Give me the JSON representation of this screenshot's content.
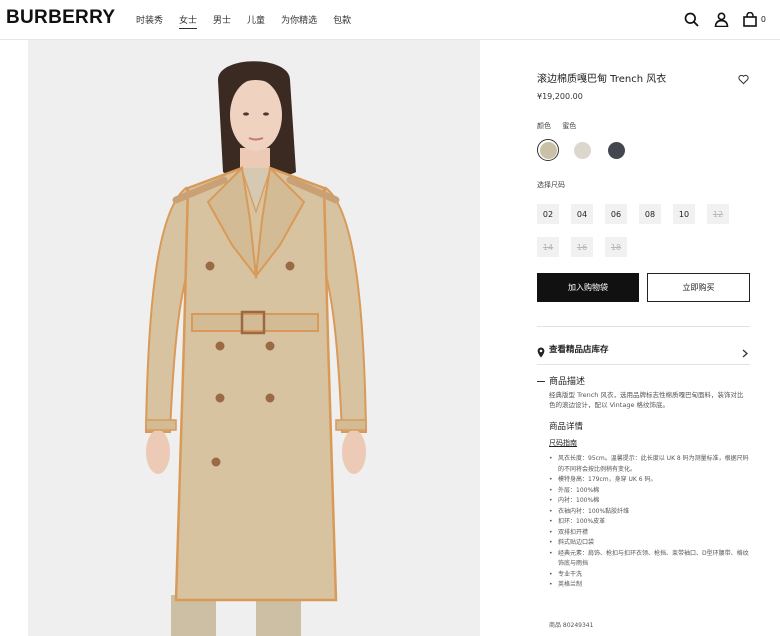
{
  "header": {
    "logo": "BURBERRY",
    "nav": [
      "时装秀",
      "女士",
      "男士",
      "儿童",
      "为你精选",
      "包款"
    ],
    "active_nav": "女士",
    "bag_count": "0"
  },
  "icons": {
    "search": "search-icon",
    "account": "user-icon",
    "bag": "shopping-bag-icon",
    "wishlist": "heart-icon",
    "store": "location-pin-icon",
    "chevron": "chevron-right-icon"
  },
  "product": {
    "title": "滚边棉质嘎巴甸 Trench 风衣",
    "price": "¥19,200.00",
    "colour_label": "颜色",
    "colour_selected": "蜜色",
    "colours": [
      {
        "name": "honey",
        "hex": "#c9c0a6",
        "selected": true
      },
      {
        "name": "stone",
        "hex": "#dcd7cc",
        "selected": false
      },
      {
        "name": "navy",
        "hex": "#45474f",
        "selected": false
      }
    ],
    "size_label": "选择尺码",
    "sizes": [
      {
        "label": "02",
        "available": true
      },
      {
        "label": "04",
        "available": true
      },
      {
        "label": "06",
        "available": true
      },
      {
        "label": "08",
        "available": true
      },
      {
        "label": "10",
        "available": true
      },
      {
        "label": "12",
        "available": false
      },
      {
        "label": "14",
        "available": false
      },
      {
        "label": "16",
        "available": false
      },
      {
        "label": "18",
        "available": false
      }
    ],
    "add_to_cart": "加入购物袋",
    "buy_now": "立即购买",
    "store_stock": "查看精品店库存",
    "description_title": "商品描述",
    "description": "经典版型 Trench 风衣，选用品牌标志性棉质嘎巴甸面料，装饰对比色的滚边设计，配以 Vintage 格纹饰底。",
    "details_title": "商品详情",
    "size_guide": "尺码指南",
    "details": [
      "风衣长度：95cm。温馨提示：此长度以 UK 8 码为测量标准，根据尺码的不同将会按比例稍有变化。",
      "模特身高：179cm，身穿 UK 6 码。",
      "外层：100%棉",
      "内衬：100%棉",
      "衣袖内衬：100%黏胶纤维",
      "扣环：100%皮革",
      "双排扣开襟",
      "斜式贴边口袋",
      "经典元素：肩饰、枪扣与扣环衣领、枪挡、束带袖口、D型环腰带、格纹饰底与雨挡",
      "专业干洗",
      "英格兰制"
    ],
    "product_code": "商品 80249341"
  },
  "colors": {
    "accent": "#111111",
    "coat": "#d8c3a0",
    "piping": "#d99a58",
    "button": "#9a6a45"
  }
}
